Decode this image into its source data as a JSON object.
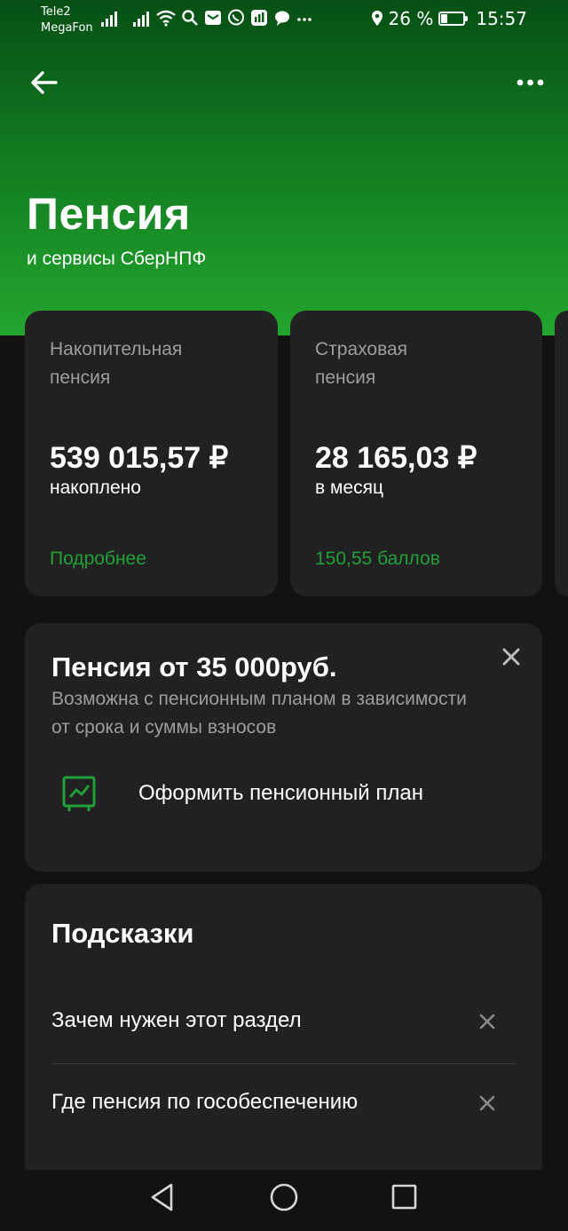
{
  "status_bar": {
    "carrier_1": "Tele2",
    "carrier_2": "MegaFon",
    "battery": "26 %",
    "battery_level": 0.26,
    "time": "15:57"
  },
  "header": {
    "title": "Пенсия",
    "subtitle": "и сервисы СберНПФ"
  },
  "cards": [
    {
      "label": "Накопительная\nпенсия",
      "amount": "539 015,57 ₽",
      "caption": "накоплено",
      "link": "Подробнее"
    },
    {
      "label": "Страховая\nпенсия",
      "amount": "28 165,03 ₽",
      "caption": "в месяц",
      "link": "150,55 баллов"
    }
  ],
  "promo": {
    "title": "Пенсия от 35 000руб.",
    "description": "Возможна с пенсионным планом в зависимости от срока и суммы взносов",
    "action_label": "Оформить пенсионный план"
  },
  "tips": {
    "title": "Подсказки",
    "items": [
      {
        "label": "Зачем нужен этот раздел"
      },
      {
        "label": "Где пенсия по гособеспечению"
      }
    ]
  },
  "colors": {
    "accent": "#21a038",
    "background": "#121212",
    "card": "#212121",
    "secondary_text": "#9d9d9d"
  }
}
